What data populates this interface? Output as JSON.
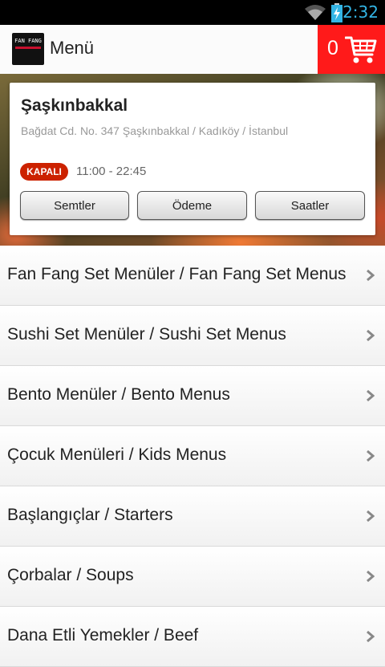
{
  "status_bar": {
    "time": "2:32",
    "wifi_icon": "wifi-icon",
    "battery_icon": "battery-charging-icon"
  },
  "action_bar": {
    "logo_text": "FAN FANG",
    "title": "Menü",
    "cart_count": "0",
    "cart_icon": "cart-icon",
    "accent_color": "#ff1a1a"
  },
  "restaurant": {
    "name": "Şaşkınbakkal",
    "address": "Bağdat Cd. No. 347 Şaşkınbakkal / Kadıköy / İstanbul",
    "status_badge": "KAPALI",
    "hours": "11:00 - 22:45",
    "buttons": [
      "Semtler",
      "Ödeme",
      "Saatler"
    ]
  },
  "menu_categories": [
    "Fan Fang Set Menüler / Fan Fang Set Menus",
    "Sushi Set Menüler / Sushi Set Menus",
    "Bento Menüler / Bento Menus",
    "Çocuk Menüleri / Kids Menus",
    "Başlangıçlar / Starters",
    "Çorbalar / Soups",
    "Dana Etli Yemekler / Beef"
  ]
}
